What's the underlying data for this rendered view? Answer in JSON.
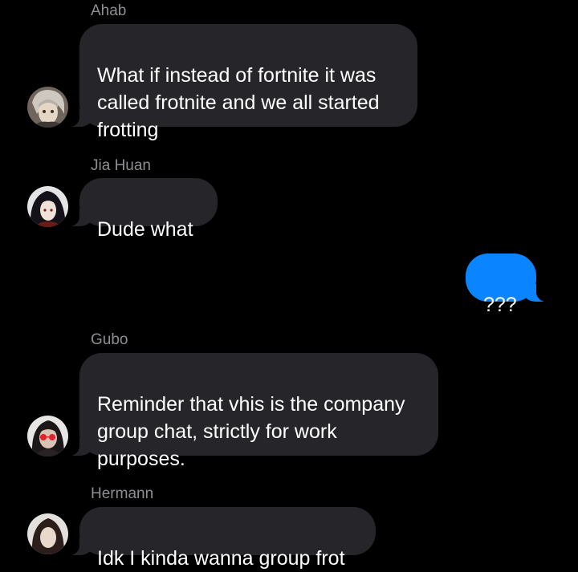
{
  "messages": [
    {
      "sender": "Ahab",
      "text": "What if instead of fortnite it was\ncalled frotnite and we all started\nfrotting",
      "avatar": "avatar-ahab"
    },
    {
      "sender": "Jia Huan",
      "text": "Dude what",
      "avatar": "avatar-jia-huan"
    },
    {
      "sender": "",
      "text": "???",
      "outgoing": true
    },
    {
      "sender": "Gubo",
      "text": "Reminder that vhis is the company\ngroup chat, strictly for work\npurposes.",
      "avatar": "avatar-gubo"
    },
    {
      "sender": "Hermann",
      "text": "Idk I kinda wanna group frot",
      "avatar": "avatar-hermann"
    }
  ],
  "colors": {
    "background": "#000000",
    "incoming_bubble": "#262529",
    "outgoing_bubble": "#0a84ff",
    "sender_name": "#8e8e93",
    "text": "#ffffff"
  }
}
